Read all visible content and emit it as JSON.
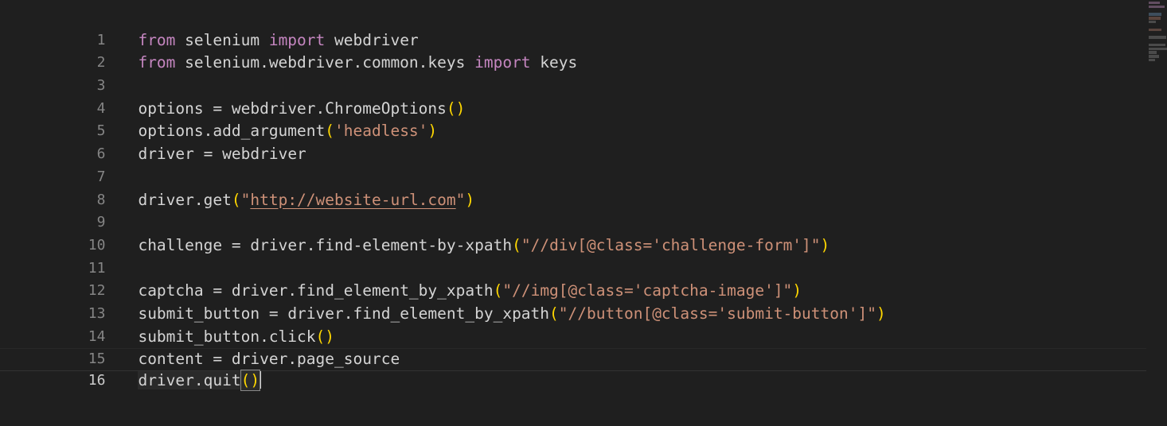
{
  "editor": {
    "language": "python",
    "theme": "dark-plus",
    "background_color": "#1f1f1f",
    "line_number_color": "#858585",
    "active_line_number_color": "#cccccc",
    "keyword_color": "#c586c0",
    "string_color": "#ce9178",
    "bracket_color": "#ffd700",
    "variable_color": "#9cdcfe",
    "default_text_color": "#d4d4d4",
    "clipped_top_line_text": "()"
  },
  "cursor": {
    "line": "16",
    "column": "15"
  },
  "line_numbers": [
    "1",
    "2",
    "3",
    "4",
    "5",
    "6",
    "7",
    "8",
    "9",
    "10",
    "11",
    "12",
    "13",
    "14",
    "15",
    "16"
  ],
  "code_lines": [
    {
      "number": "1",
      "text": "from selenium import webdriver"
    },
    {
      "number": "2",
      "text": "from selenium.webdriver.common.keys import keys"
    },
    {
      "number": "3",
      "text": ""
    },
    {
      "number": "4",
      "text": "options = webdriver.ChromeOptions()"
    },
    {
      "number": "5",
      "text": "options.add_argument('headless')"
    },
    {
      "number": "6",
      "text": "driver = webdriver"
    },
    {
      "number": "7",
      "text": ""
    },
    {
      "number": "8",
      "text": "driver.get(\"http://website-url.com\")"
    },
    {
      "number": "9",
      "text": ""
    },
    {
      "number": "10",
      "text": "challenge = driver.find-element-by-xpath(\"//div[@class='challenge-form']\")"
    },
    {
      "number": "11",
      "text": ""
    },
    {
      "number": "12",
      "text": "captcha = driver.find_element_by_xpath(\"//img[@class='captcha-image']\")"
    },
    {
      "number": "13",
      "text": "submit_button = driver.find_element_by_xpath(\"//button[@class='submit-button']\")"
    },
    {
      "number": "14",
      "text": "submit_button.click()"
    },
    {
      "number": "15",
      "text": "content = driver.page_source"
    },
    {
      "number": "16",
      "text": "driver.quit()"
    }
  ],
  "tokens": {
    "l1": {
      "kw_from": "from",
      "mod": " selenium ",
      "kw_import": "import",
      "name": " webdriver"
    },
    "l2": {
      "kw_from": "from",
      "mod": " selenium.webdriver.common.keys ",
      "kw_import": "import",
      "name": " keys"
    },
    "l4": {
      "var": "options",
      "op": " = ",
      "obj": "webdriver.ChromeOptions",
      "open": "(",
      "close": ")"
    },
    "l5": {
      "obj": "options.add_argument",
      "open": "(",
      "str": "'headless'",
      "close": ")"
    },
    "l6": {
      "var": "driver",
      "op": " = ",
      "name": "webdriver"
    },
    "l8": {
      "obj": "driver.get",
      "open": "(",
      "quote_open": "\"",
      "url": "http://website-url.com",
      "quote_close": "\"",
      "close": ")"
    },
    "l10": {
      "var": "challenge",
      "op": " = ",
      "obj": "driver.find-element-by-xpath",
      "open": "(",
      "str": "\"//div[@class='challenge-form']\"",
      "close": ")"
    },
    "l12": {
      "var": "captcha",
      "op": " = ",
      "obj": "driver.find_element_by_xpath",
      "open": "(",
      "str": "\"//img[@class='captcha-image']\"",
      "close": ")"
    },
    "l13": {
      "var": "submit_button",
      "op": " = ",
      "obj": "driver.find_element_by_xpath",
      "open": "(",
      "str": "\"//button[@class='submit-button']\"",
      "close": ")"
    },
    "l14": {
      "obj": "submit_button.click",
      "open": "(",
      "close": ")"
    },
    "l15": {
      "var": "content",
      "op": " = ",
      "name": "driver.page_source"
    },
    "l16": {
      "obj": "driver.quit",
      "brackets": "()"
    }
  },
  "minimap": {
    "visible": "true",
    "position": "right"
  }
}
